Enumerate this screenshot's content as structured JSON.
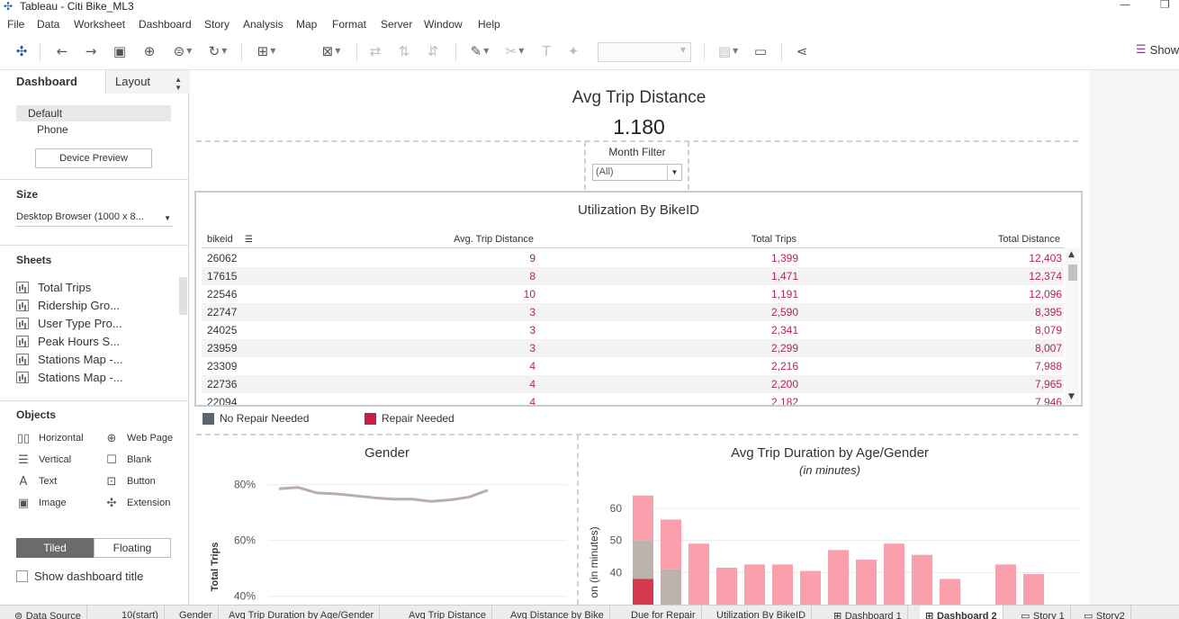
{
  "window": {
    "title": "Tableau - Citi Bike_ML3",
    "minimize_glyph": "—",
    "maximize_glyph": "❐"
  },
  "menu": [
    "File",
    "Data",
    "Worksheet",
    "Dashboard",
    "Story",
    "Analysis",
    "Map",
    "Format",
    "Server",
    "Window",
    "Help"
  ],
  "toolbar": {
    "icons": [
      "tableau-logo-icon",
      "undo-icon",
      "redo-icon",
      "save-icon",
      "new-datasource-icon",
      "datasource-options-icon",
      "refresh-icon",
      "new-worksheet-icon",
      "swap-icon",
      "sort-ascending-icon",
      "sort-descending-icon",
      "highlight-icon",
      "group-icon",
      "label-icon",
      "pin-icon",
      "cards-icon",
      "presentation-icon",
      "share-icon"
    ],
    "show_me_label": "Show"
  },
  "left_pane": {
    "tab_dashboard": "Dashboard",
    "tab_layout": "Layout",
    "device_default": "Default",
    "device_phone": "Phone",
    "device_preview_button": "Device Preview",
    "size_heading": "Size",
    "size_value": "Desktop Browser (1000 x 8...",
    "sheets_heading": "Sheets",
    "sheets": [
      "Total Trips",
      "Ridership Gro...",
      "User Type Pro...",
      "Peak Hours S...",
      "Stations Map -...",
      "Stations Map -..."
    ],
    "objects_heading": "Objects",
    "objects": [
      {
        "label": "Horizontal",
        "icon": "horizontal-container-icon",
        "glyph": "▯▯"
      },
      {
        "label": "Web Page",
        "icon": "globe-icon",
        "glyph": "⊕"
      },
      {
        "label": "Vertical",
        "icon": "vertical-container-icon",
        "glyph": "☰"
      },
      {
        "label": "Blank",
        "icon": "blank-icon",
        "glyph": "☐"
      },
      {
        "label": "Text",
        "icon": "text-icon",
        "glyph": "A"
      },
      {
        "label": "Button",
        "icon": "button-icon",
        "glyph": "⊡"
      },
      {
        "label": "Image",
        "icon": "image-icon",
        "glyph": "▣"
      },
      {
        "label": "Extension",
        "icon": "extension-icon",
        "glyph": "✣"
      }
    ],
    "tiled_label": "Tiled",
    "floating_label": "Floating",
    "show_title_label": "Show dashboard title"
  },
  "dashboard": {
    "kpi_title": "Avg Trip Distance",
    "kpi_value": "1.180",
    "filter_label": "Month Filter",
    "filter_value": "(All)",
    "table": {
      "title": "Utilization By BikeID",
      "columns": [
        "bikeid",
        "Avg. Trip Distance",
        "Total Trips",
        "Total Distance"
      ],
      "rows": [
        [
          "26062",
          "9",
          "1,399",
          "12,403"
        ],
        [
          "17615",
          "8",
          "1,471",
          "12,374"
        ],
        [
          "22546",
          "10",
          "1,191",
          "12,096"
        ],
        [
          "22747",
          "3",
          "2,590",
          "8,395"
        ],
        [
          "24025",
          "3",
          "2,341",
          "8,079"
        ],
        [
          "23959",
          "3",
          "2,299",
          "8,007"
        ],
        [
          "23309",
          "4",
          "2,216",
          "7,988"
        ],
        [
          "22736",
          "4",
          "2,200",
          "7,965"
        ],
        [
          "22094",
          "4",
          "2,182",
          "7,946"
        ]
      ]
    },
    "legend": [
      {
        "label": "No Repair Needed",
        "color": "#5b6570"
      },
      {
        "label": "Repair Needed",
        "color": "#c51f43"
      }
    ]
  },
  "chart_data": [
    {
      "type": "line",
      "title": "Gender",
      "ylabel": "Total Trips",
      "yticks": [
        "80%",
        "60%",
        "40%"
      ],
      "ylim": [
        0.37,
        0.86
      ],
      "color": "#bbaea8",
      "series": [
        {
          "values": [
            0.785,
            0.79,
            0.77,
            0.767,
            0.76,
            0.753,
            0.748,
            0.748,
            0.74,
            0.745,
            0.755,
            0.78
          ]
        }
      ]
    },
    {
      "type": "bar",
      "title": "Avg Trip Duration by Age/Gender",
      "subtitle": "(in minutes)",
      "ylabel": "on (in minutes)",
      "yticks": [
        60,
        50,
        40
      ],
      "ylim": [
        30,
        67
      ],
      "colors": {
        "pink": "#f9a0ac",
        "grey": "#bdb2ae",
        "red": "#d33a4e"
      },
      "bars": [
        {
          "segments": [
            {
              "from": 50,
              "to": 64,
              "color": "pink"
            },
            {
              "from": 38,
              "to": 50,
              "color": "grey"
            },
            {
              "from": 0,
              "to": 38,
              "color": "red"
            }
          ]
        },
        {
          "segments": [
            {
              "from": 41,
              "to": 56.5,
              "color": "pink"
            },
            {
              "from": 0,
              "to": 41,
              "color": "grey"
            }
          ]
        },
        {
          "segments": [
            {
              "from": 0,
              "to": 49,
              "color": "pink"
            }
          ]
        },
        {
          "segments": [
            {
              "from": 0,
              "to": 41.5,
              "color": "pink"
            }
          ]
        },
        {
          "segments": [
            {
              "from": 0,
              "to": 42.5,
              "color": "pink"
            }
          ]
        },
        {
          "segments": [
            {
              "from": 0,
              "to": 42.5,
              "color": "pink"
            }
          ]
        },
        {
          "segments": [
            {
              "from": 0,
              "to": 40.5,
              "color": "pink"
            }
          ]
        },
        {
          "segments": [
            {
              "from": 0,
              "to": 47,
              "color": "pink"
            }
          ]
        },
        {
          "segments": [
            {
              "from": 0,
              "to": 44,
              "color": "pink"
            }
          ]
        },
        {
          "segments": [
            {
              "from": 0,
              "to": 49,
              "color": "pink"
            }
          ]
        },
        {
          "segments": [
            {
              "from": 0,
              "to": 45.5,
              "color": "pink"
            }
          ]
        },
        {
          "segments": [
            {
              "from": 0,
              "to": 38,
              "color": "pink"
            }
          ]
        },
        {
          "segments": []
        },
        {
          "segments": [
            {
              "from": 0,
              "to": 42.5,
              "color": "pink"
            }
          ]
        },
        {
          "segments": [
            {
              "from": 0,
              "to": 39.5,
              "color": "pink"
            }
          ]
        }
      ]
    }
  ],
  "bottom_tabs": [
    {
      "label": "Data Source",
      "icon": "datasource-icon"
    },
    {
      "label": "10(start)"
    },
    {
      "label": "Gender"
    },
    {
      "label": "Avg Trip Duration by Age/Gender"
    },
    {
      "label": "Avg Trip Distance"
    },
    {
      "label": "Avg Distance by Bike"
    },
    {
      "label": "Due for Repair"
    },
    {
      "label": "Utilization By BikeID"
    },
    {
      "label": "Dashboard 1",
      "icon": "dashboard-icon"
    },
    {
      "label": "Dashboard 2",
      "icon": "dashboard-icon",
      "active": true
    },
    {
      "label": "Story 1",
      "icon": "story-icon"
    },
    {
      "label": "Story2",
      "icon": "story-icon"
    }
  ]
}
